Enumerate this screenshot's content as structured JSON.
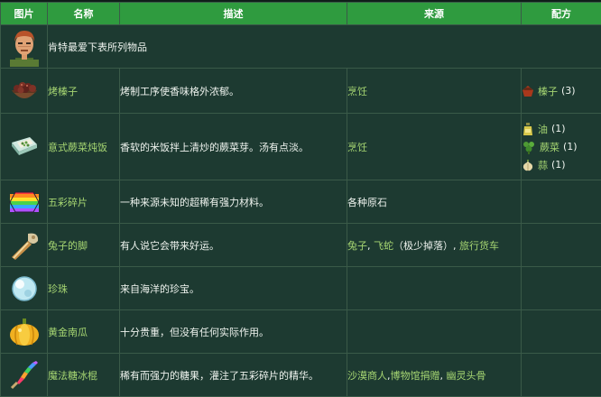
{
  "headers": {
    "image": "图片",
    "name": "名称",
    "desc": "描述",
    "source": "来源",
    "recipe": "配方"
  },
  "intro": "肯特最爱下表所列物品",
  "items": [
    {
      "icon": "roasted-hazelnuts-icon",
      "name": "烤榛子",
      "desc": "烤制工序使香味格外浓郁。",
      "source": "烹饪",
      "recipe": [
        {
          "icon": "hazelnut-icon",
          "name": "榛子",
          "qty": "(3)"
        }
      ]
    },
    {
      "icon": "fern-risotto-icon",
      "name": "意式蕨菜炖饭",
      "desc": "香软的米饭拌上清炒的蕨菜芽。汤有点淡。",
      "source": "烹饪",
      "recipe": [
        {
          "icon": "oil-icon",
          "name": "油",
          "qty": "(1)"
        },
        {
          "icon": "fiddlehead-fern-icon",
          "name": "蕨菜",
          "qty": "(1)"
        },
        {
          "icon": "garlic-icon",
          "name": "蒜",
          "qty": "(1)"
        }
      ]
    },
    {
      "icon": "prismatic-shard-icon",
      "name": "五彩碎片",
      "desc": "一种来源未知的超稀有强力材料。",
      "source": "各种原石",
      "recipe": []
    },
    {
      "icon": "rabbits-foot-icon",
      "name": "兔子的脚",
      "desc": "有人说它会带来好运。",
      "source_parts": {
        "a": "兔子",
        "sep1": ", ",
        "b": "飞蛇",
        "mid": "（极少掉落）",
        "sep2": ", ",
        "c": "旅行货车"
      },
      "recipe": []
    },
    {
      "icon": "pearl-icon",
      "name": "珍珠",
      "desc": "来自海洋的珍宝。",
      "source": "",
      "recipe": []
    },
    {
      "icon": "golden-pumpkin-icon",
      "name": "黄金南瓜",
      "desc": "十分贵重，但没有任何实际作用。",
      "source": "",
      "recipe": []
    },
    {
      "icon": "magic-rock-candy-icon",
      "name": "魔法糖冰棍",
      "desc": "稀有而强力的糖果，灌注了五彩碎片的精华。",
      "source_parts": {
        "a": "沙漠商人",
        "sep1": ",",
        "b": "博物馆捐赠",
        "sep2": ", ",
        "c": "幽灵头骨"
      },
      "recipe": []
    }
  ]
}
